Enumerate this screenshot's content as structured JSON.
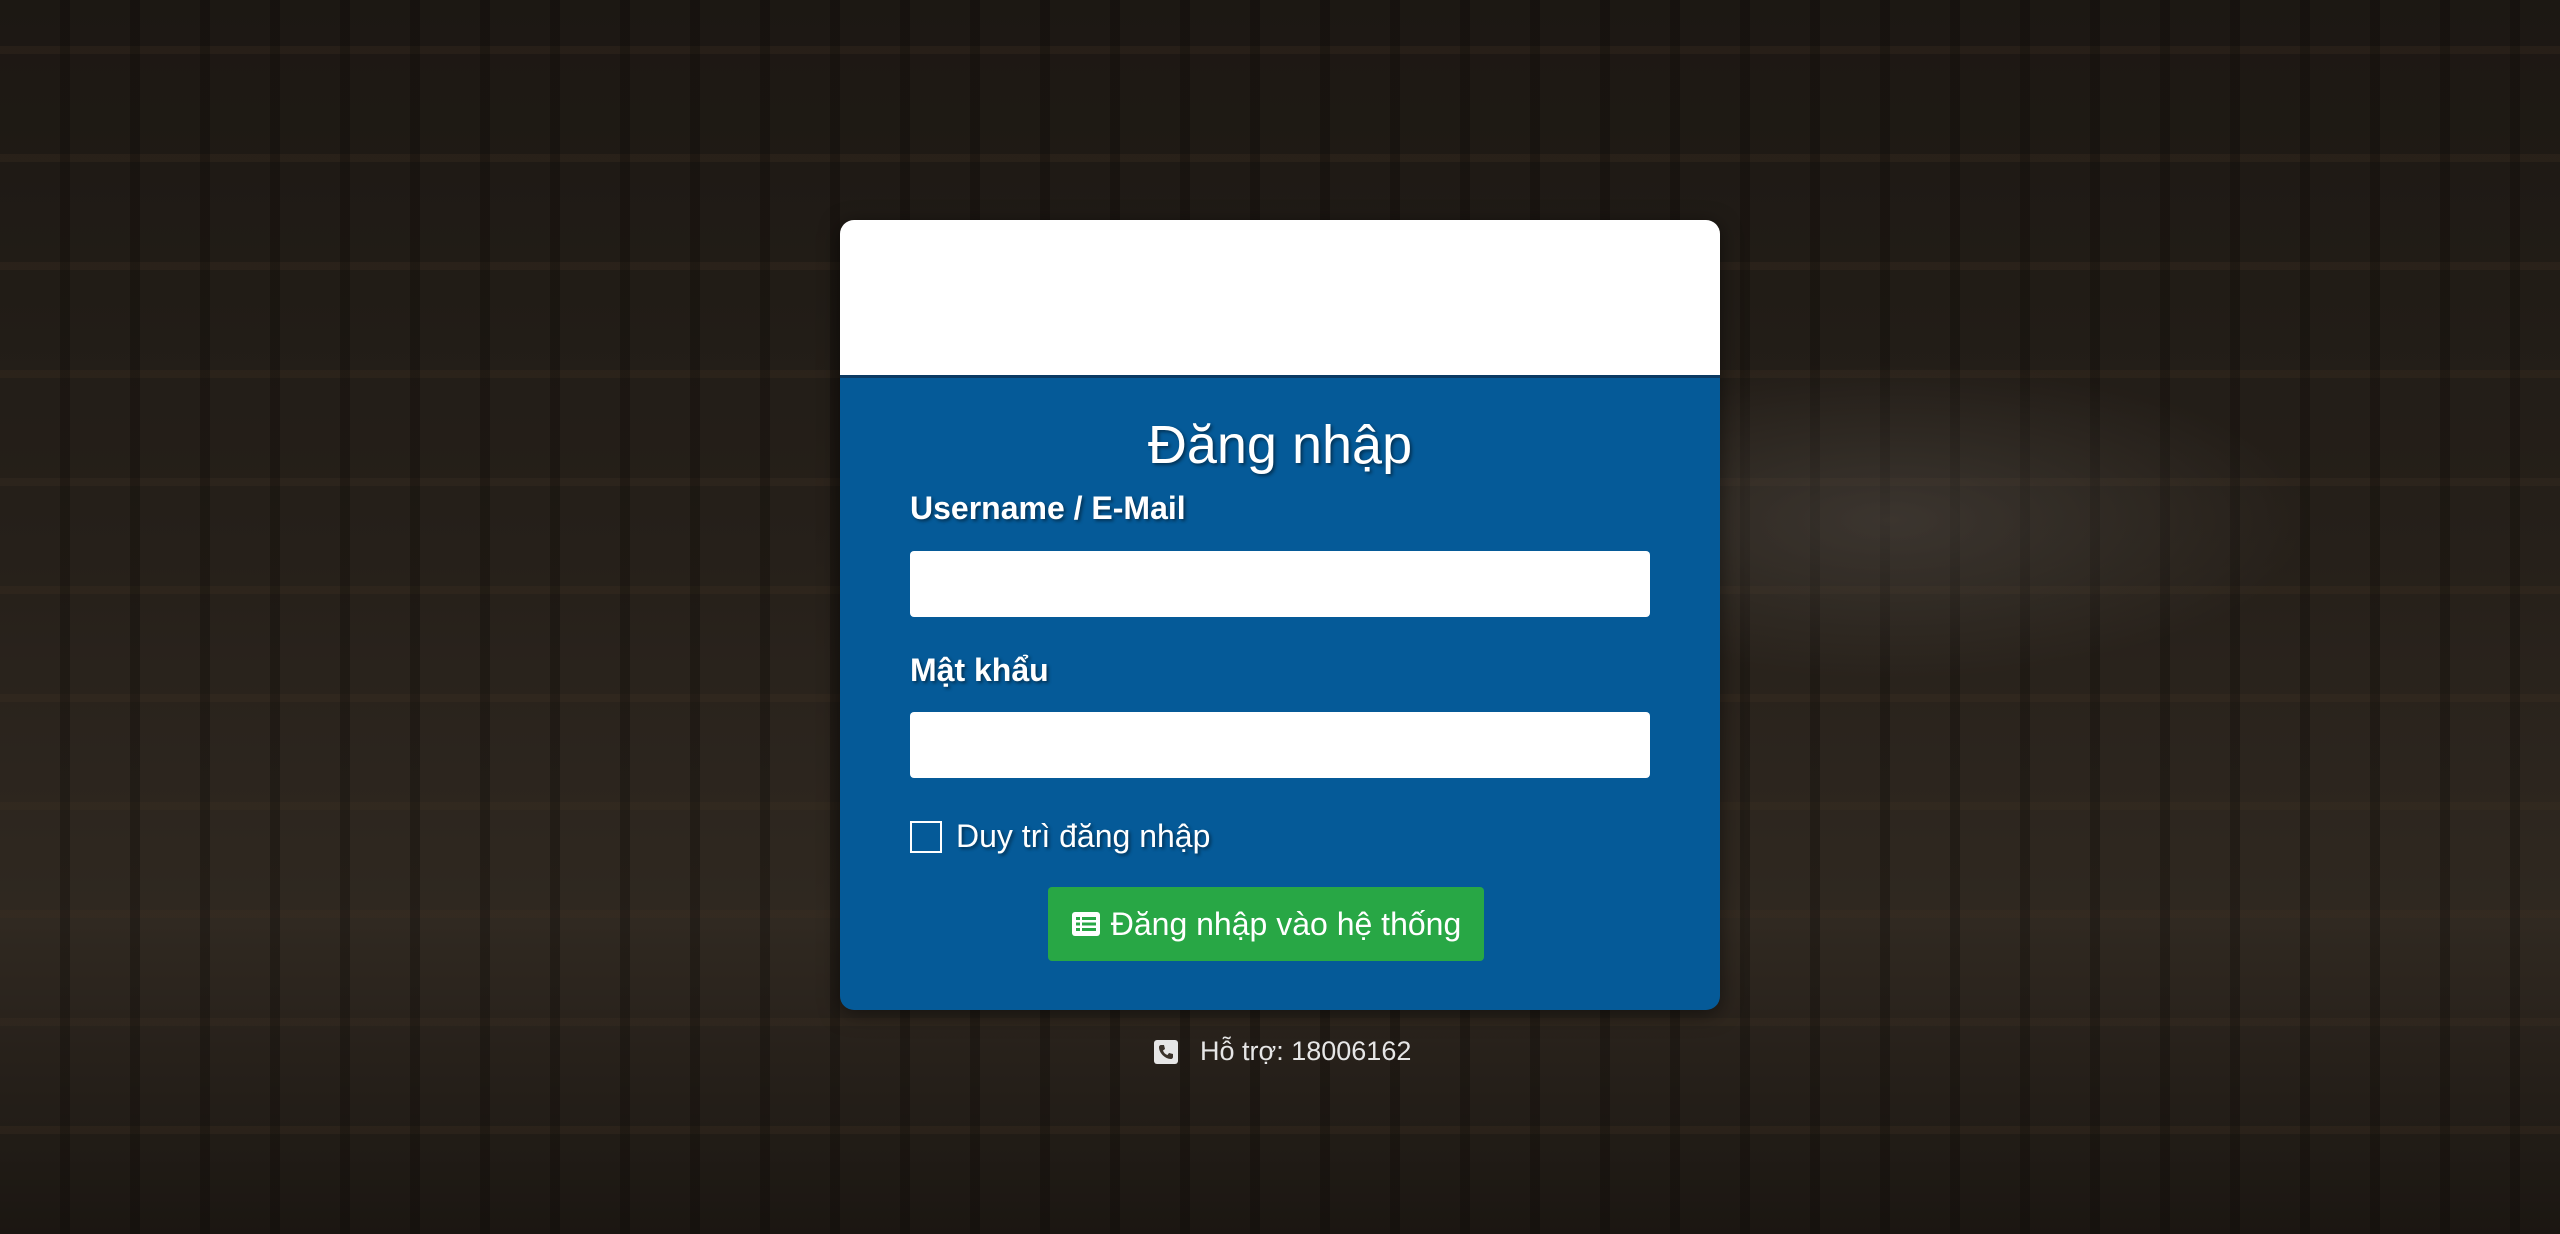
{
  "login": {
    "title": "Đăng nhập",
    "username_label": "Username / E-Mail",
    "username_value": "",
    "password_label": "Mật khẩu",
    "password_value": "",
    "remember_label": "Duy trì đăng nhập",
    "remember_checked": false,
    "submit_label": "Đăng nhập vào hệ thống",
    "submit_icon": "list-icon"
  },
  "footer": {
    "support_text": "Hỗ trợ: 18006162",
    "support_icon": "phone-square-icon"
  },
  "colors": {
    "panel": "#055a98",
    "button": "#28a745",
    "header": "#ffffff"
  }
}
